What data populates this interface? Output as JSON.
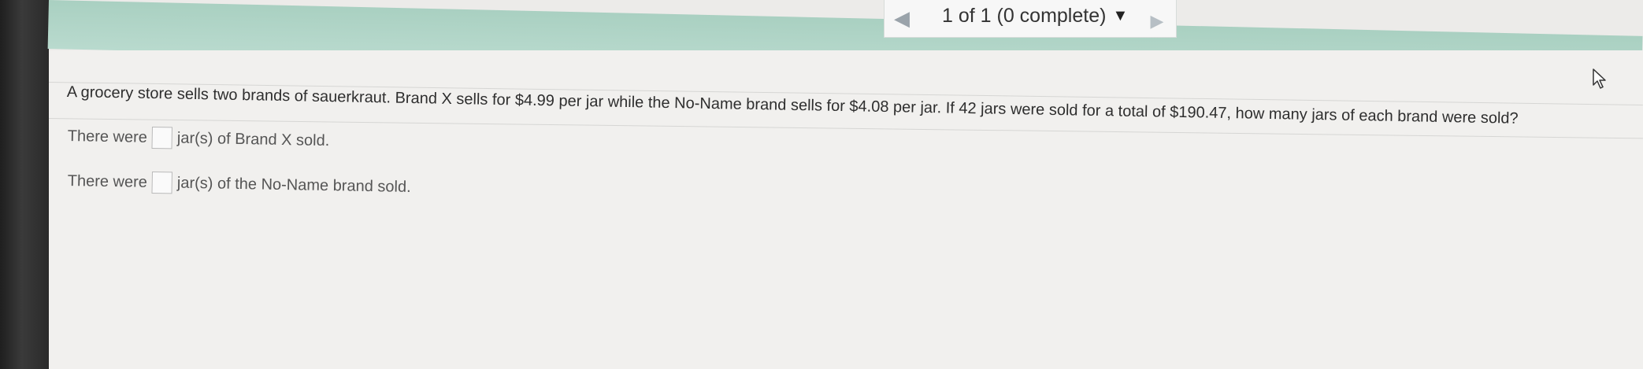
{
  "header": {
    "progress_text": "1 of 1 (0 complete)",
    "prev_icon": "left-triangle",
    "next_icon": "right-triangle",
    "dropdown_icon": "caret-down"
  },
  "question": {
    "text": "A grocery store sells two brands of sauerkraut. Brand X sells for $4.99 per jar while the No-Name brand sells for $4.08 per jar. If 42 jars were sold for a total of $190.47, how many jars of each brand were sold?"
  },
  "answers": [
    {
      "prefix": "There were",
      "value": "",
      "suffix": "jar(s) of Brand X sold."
    },
    {
      "prefix": "There were",
      "value": "",
      "suffix": "jar(s) of the No-Name brand sold."
    }
  ],
  "colors": {
    "header_bar": "#b3d6c8",
    "page_background": "#f1f0ee"
  },
  "pointer_icon": "mouse-pointer"
}
